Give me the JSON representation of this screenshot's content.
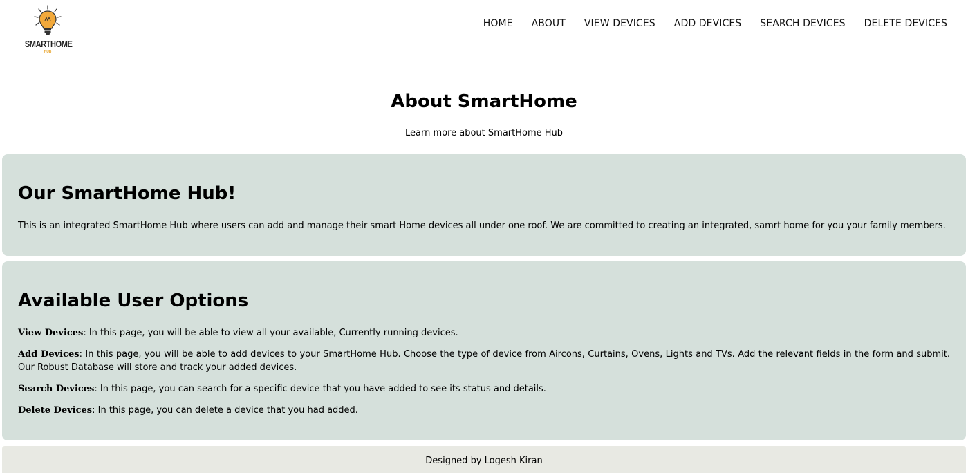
{
  "logo": {
    "name": "SMARTHOME",
    "sub": "HUB"
  },
  "nav": {
    "items": [
      "HOME",
      "ABOUT",
      "VIEW DEVICES",
      "ADD DEVICES",
      "SEARCH DEVICES",
      "DELETE DEVICES"
    ]
  },
  "hero": {
    "title": "About SmartHome",
    "subtitle": "Learn more about SmartHome Hub"
  },
  "hub": {
    "heading": "Our SmartHome Hub!",
    "text": "This is an integrated SmartHome Hub where users can add and manage their smart Home devices all under one roof. We are committed to creating an integrated, samrt home for you your family members."
  },
  "options": {
    "heading": "Available User Options",
    "items": [
      {
        "label": "View Devices",
        "text": ": In this page, you will be able to view all your available, Currently running devices."
      },
      {
        "label": "Add Devices",
        "text": ": In this page, you will be able to add devices to your SmartHome Hub. Choose the type of device from Aircons, Curtains, Ovens, Lights and TVs. Add the relevant fields in the form and submit. Our Robust Database will store and track your added devices."
      },
      {
        "label": "Search Devices",
        "text": ": In this page, you can search for a specific device that you have added to see its status and details."
      },
      {
        "label": "Delete Devices",
        "text": ": In this page, you can delete a device that you had added."
      }
    ]
  },
  "footer": {
    "text": "Designed by Logesh Kiran"
  },
  "colors": {
    "panel": "#d5e0db",
    "footer": "#e8e9e3",
    "logo_accent": "#f2a93b"
  }
}
